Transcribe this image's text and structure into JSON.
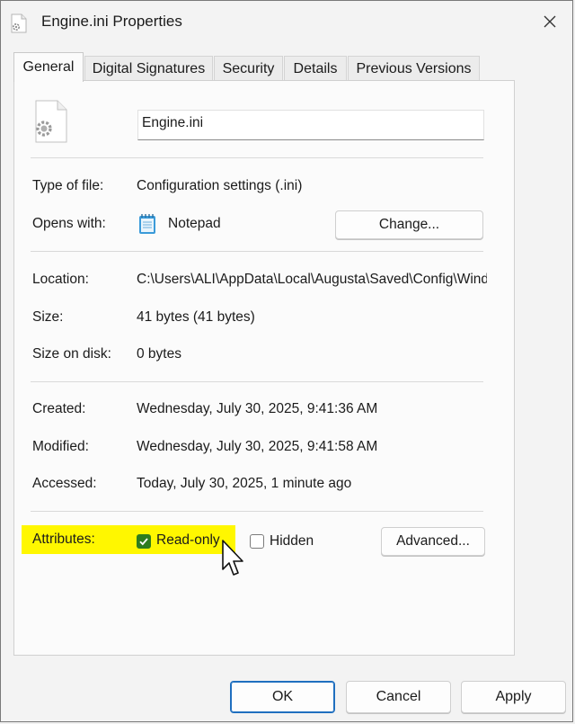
{
  "window": {
    "title": "Engine.ini Properties"
  },
  "tabs": [
    {
      "label": "General",
      "active": true
    },
    {
      "label": "Digital Signatures",
      "active": false
    },
    {
      "label": "Security",
      "active": false
    },
    {
      "label": "Details",
      "active": false
    },
    {
      "label": "Previous Versions",
      "active": false
    }
  ],
  "general": {
    "file_name": "Engine.ini",
    "type_label": "Type of file:",
    "type_value": "Configuration settings (.ini)",
    "opens_label": "Opens with:",
    "opens_value": "Notepad",
    "change_button": "Change...",
    "location_label": "Location:",
    "location_value": "C:\\Users\\ALI\\AppData\\Local\\Augusta\\Saved\\Config\\Windows",
    "size_label": "Size:",
    "size_value": "41 bytes (41 bytes)",
    "size_disk_label": "Size on disk:",
    "size_disk_value": "0 bytes",
    "created_label": "Created:",
    "created_value": "Wednesday, July 30, 2025, 9:41:36 AM",
    "modified_label": "Modified:",
    "modified_value": "Wednesday, July 30, 2025, 9:41:58 AM",
    "accessed_label": "Accessed:",
    "accessed_value": "Today, July 30, 2025, 1 minute ago",
    "attributes_label": "Attributes:",
    "readonly_label": "Read-only",
    "readonly_checked": true,
    "hidden_label": "Hidden",
    "hidden_checked": false,
    "advanced_button": "Advanced..."
  },
  "footer": {
    "ok": "OK",
    "cancel": "Cancel",
    "apply": "Apply"
  },
  "colors": {
    "highlight": "#fff700",
    "checkbox_checked": "#2e7d1f",
    "default_button_border": "#1f6fbf"
  }
}
